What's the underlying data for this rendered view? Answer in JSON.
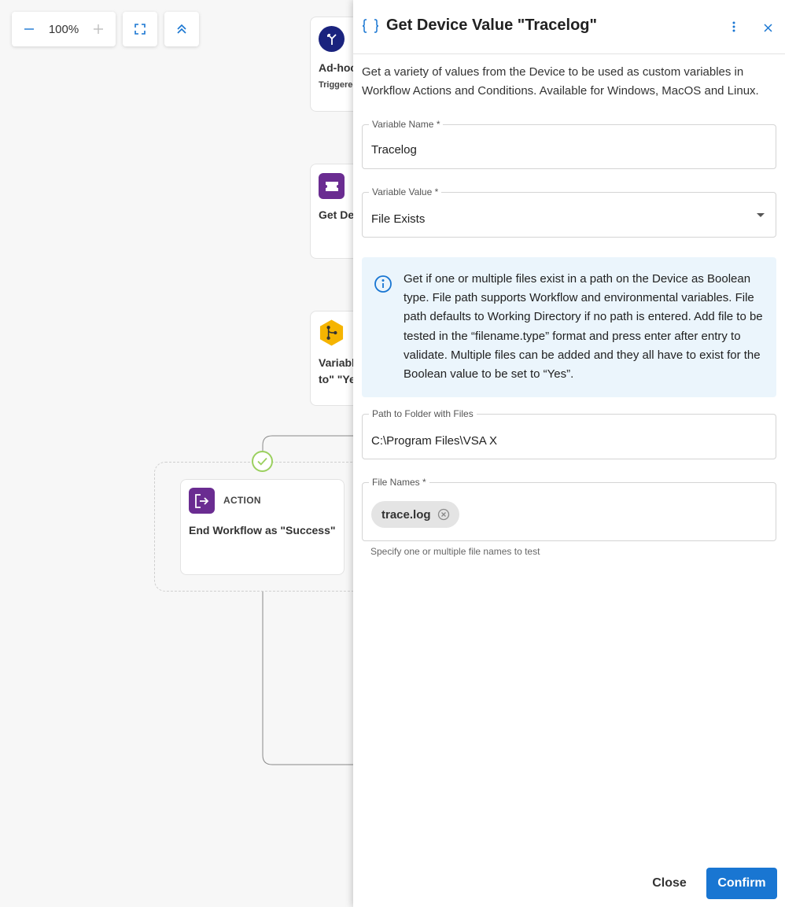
{
  "toolbar": {
    "zoom_level": "100%"
  },
  "canvas": {
    "nodes": [
      {
        "title": "Ad-hoc",
        "subtitle": "Triggered"
      },
      {
        "title": "Get Dev"
      },
      {
        "title_line1": "Variabl",
        "title_line2": "to\" \"Yes"
      },
      {
        "type": "ACTION",
        "title": "End Workflow as \"Success\""
      }
    ]
  },
  "panel": {
    "title": "Get Device Value \"Tracelog\"",
    "description": "Get a variety of values from the Device to be used as custom variables in Workflow Actions and Conditions. Available for Windows, MacOS and Linux.",
    "variable_name": {
      "label": "Variable Name *",
      "value": "Tracelog"
    },
    "variable_value": {
      "label": "Variable Value *",
      "value": "File Exists"
    },
    "info": "Get if one or multiple files exist in a path on the Device as Boolean type. File path supports Workflow and environmental variables. File path defaults to Working Directory if no path is entered. Add file to be tested in the “filename.type” format and press enter after entry to validate. Multiple files can be added and they all have to exist for the Boolean value to be set to “Yes”.",
    "path": {
      "label": "Path to Folder with Files",
      "value": "C:\\Program Files\\VSA X"
    },
    "file_names": {
      "label": "File Names *",
      "chips": [
        "trace.log"
      ],
      "helper": "Specify one or multiple file names to test"
    },
    "close_label": "Close",
    "confirm_label": "Confirm"
  },
  "colors": {
    "accent": "#1976d2",
    "trigger_icon": "#1a237e",
    "action_icon": "#6a2c91",
    "condition_icon": "#f5b400",
    "success": "#9bd05f",
    "info_bg": "#ebf5fc"
  },
  "icons": [
    "minus-icon",
    "plus-icon",
    "fit-screen-icon",
    "collapse-up-icon",
    "braces-icon",
    "more-vertical-icon",
    "close-icon",
    "info-icon",
    "dropdown-arrow-icon",
    "chip-remove-icon",
    "check-icon",
    "exit-icon",
    "ticket-icon",
    "branch-icon",
    "trigger-icon"
  ]
}
